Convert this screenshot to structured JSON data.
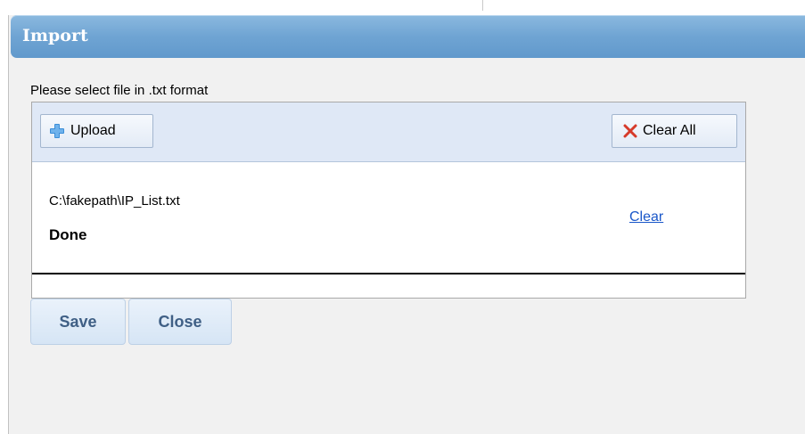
{
  "dialog": {
    "title": "Import",
    "instruction": "Please select file in .txt format"
  },
  "toolbar": {
    "upload_label": "Upload",
    "upload_icon": "plus-icon",
    "clear_all_label": "Clear All",
    "clear_all_icon": "x-icon"
  },
  "files": [
    {
      "path": "C:\\fakepath\\IP_List.txt",
      "status": "Done",
      "clear_label": "Clear"
    }
  ],
  "footer": {
    "save_label": "Save",
    "close_label": "Close"
  },
  "colors": {
    "titlebar": "#6fa4d3",
    "link": "#1a57c9",
    "clear_icon": "#d63a2a",
    "upload_icon": "#3b8ed8"
  }
}
